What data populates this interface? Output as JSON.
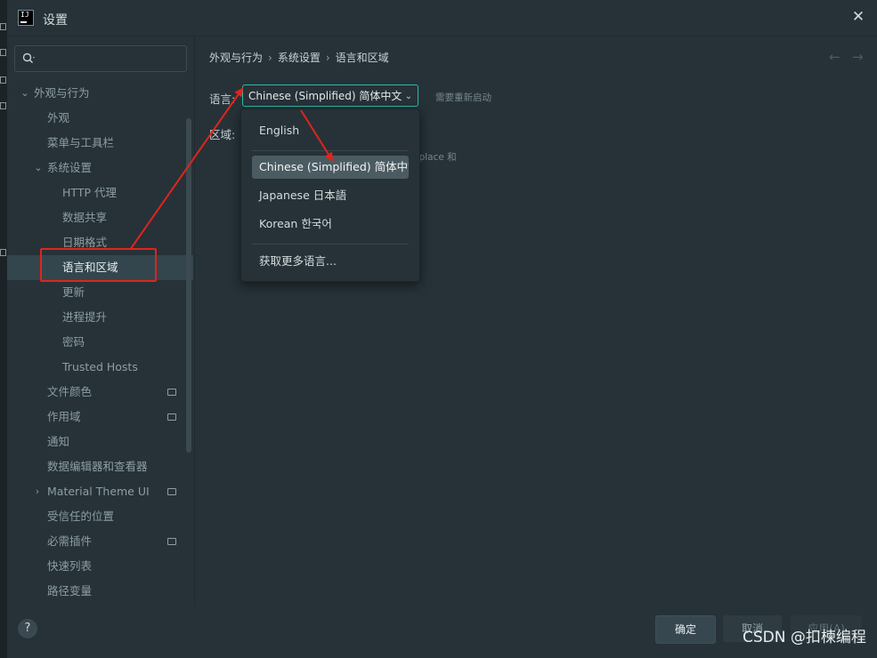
{
  "window": {
    "title": "设置",
    "close_glyph": "✕"
  },
  "sidebar": {
    "search_placeholder": "",
    "items": [
      {
        "label": "外观与行为",
        "level": 0,
        "expanded": true
      },
      {
        "label": "外观",
        "level": 1
      },
      {
        "label": "菜单与工具栏",
        "level": 1
      },
      {
        "label": "系统设置",
        "level": 1,
        "expanded": true
      },
      {
        "label": "HTTP 代理",
        "level": 2
      },
      {
        "label": "数据共享",
        "level": 2
      },
      {
        "label": "日期格式",
        "level": 2
      },
      {
        "label": "语言和区域",
        "level": 2,
        "selected": true
      },
      {
        "label": "更新",
        "level": 2
      },
      {
        "label": "进程提升",
        "level": 2
      },
      {
        "label": "密码",
        "level": 2
      },
      {
        "label": "Trusted Hosts",
        "level": 2
      },
      {
        "label": "文件颜色",
        "level": 1,
        "marker": true
      },
      {
        "label": "作用域",
        "level": 1,
        "marker": true
      },
      {
        "label": "通知",
        "level": 1
      },
      {
        "label": "数据编辑器和查看器",
        "level": 1
      },
      {
        "label": "Material Theme UI",
        "level": 1,
        "collapsed": true,
        "marker": true
      },
      {
        "label": "受信任的位置",
        "level": 1
      },
      {
        "label": "必需插件",
        "level": 1,
        "marker": true
      },
      {
        "label": "快速列表",
        "level": 1
      },
      {
        "label": "路径变量",
        "level": 1
      }
    ]
  },
  "breadcrumb": [
    "外观与行为",
    "系统设置",
    "语言和区域"
  ],
  "form": {
    "language_label": "语言:",
    "language_value": "Chinese (Simplified) 简体中文",
    "restart_hint": "需要重新启动",
    "region_label": "区域:",
    "partial_text": "etplace 和"
  },
  "dropdown": {
    "options": [
      "English",
      "Chinese (Simplified) 简体中文",
      "Japanese 日本語",
      "Korean 한국어"
    ],
    "selected_index": 1,
    "more": "获取更多语言..."
  },
  "footer": {
    "help": "?",
    "ok": "确定",
    "cancel": "取消",
    "apply": "应用(A)",
    "watermark": "CSDN @扣楝编程"
  },
  "colors": {
    "accent": "#2fb9a8",
    "annotation": "#e1241c",
    "background": "#263238"
  }
}
